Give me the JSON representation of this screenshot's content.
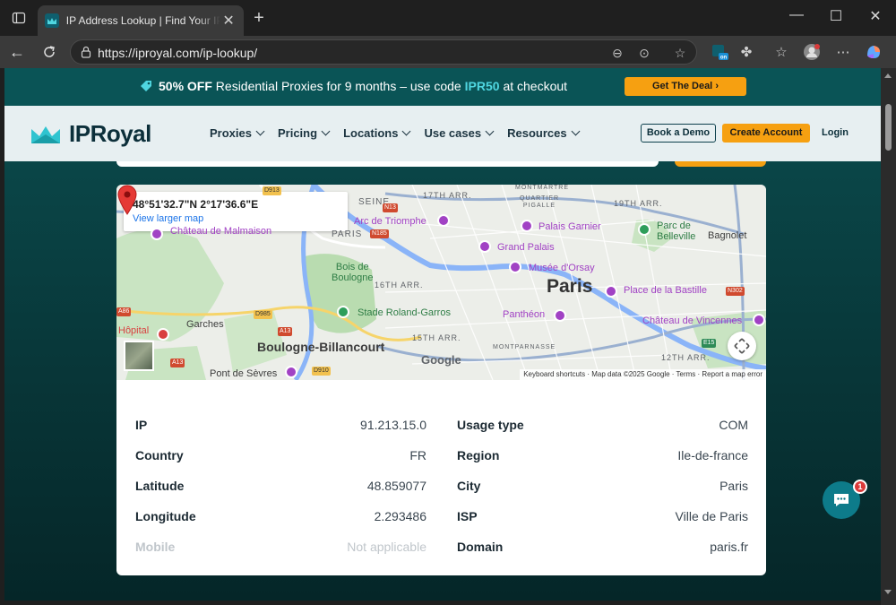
{
  "browser": {
    "tab_title": "IP Address Lookup | Find Your IP L",
    "url": "https://iproyal.com/ip-lookup/",
    "extension_badge": "on"
  },
  "promo": {
    "strong": "50% OFF",
    "text": "Residential Proxies for 9 months – use code",
    "code": "IPR50",
    "suffix": "at checkout",
    "cta": "Get The Deal"
  },
  "header": {
    "logo": "IPRoyal",
    "menu": [
      "Proxies",
      "Pricing",
      "Locations",
      "Use cases",
      "Resources"
    ],
    "book_demo": "Book a Demo",
    "create_account": "Create Account",
    "login": "Login"
  },
  "map": {
    "coordinates": "48°51'32.7\"N 2°17'36.6\"E",
    "view_larger": "View larger map",
    "labels": {
      "paris": "Paris",
      "arc": "Arc de Triomphe",
      "grand_palais": "Grand Palais",
      "palais_garnier": "Palais Garnier",
      "musee": "Musée d'Orsay",
      "bois": "Bois de\nBoulogne",
      "stade": "Stade Roland-Garros",
      "pantheon": "Panthéon",
      "bastille": "Place de la Bastille",
      "vincennes": "Château de Vincennes",
      "boulogne": "Boulogne-Billancourt",
      "garches": "Garches",
      "hopital": "Hôpital",
      "pont_sevres": "Pont de Sèvres",
      "malmaison": "Château de Malmaison",
      "belleville": "Parc de\nBelleville",
      "bagnolet": "Bagnolet",
      "montmartre": "MONTMARTRE",
      "quartier_pigalle": "QUARTIER\nPIGALLE",
      "montparnasse": "MONTPARNASSE",
      "paris_small": "PARIS",
      "seine": "SEINE",
      "arr_17": "17TH ARR.",
      "arr_19": "19TH ARR.",
      "arr_16": "16TH ARR.",
      "arr_15": "15TH ARR.",
      "arr_12": "12TH ARR."
    },
    "roads": {
      "n13": "N13",
      "n185": "N185",
      "d985": "D985",
      "a13": "A13",
      "a13b": "A13",
      "d910": "D910",
      "a86": "A86",
      "n302": "N302",
      "e15": "E15",
      "d913": "D913"
    },
    "footer": {
      "keyboard": "Keyboard shortcuts",
      "data": "Map data ©2025 Google",
      "terms": "Terms",
      "report": "Report a map error"
    },
    "google": "Google"
  },
  "info": {
    "left": [
      {
        "k": "IP",
        "v": "91.213.15.0"
      },
      {
        "k": "Country",
        "v": "FR"
      },
      {
        "k": "Latitude",
        "v": "48.859077"
      },
      {
        "k": "Longitude",
        "v": "2.293486"
      },
      {
        "k": "Mobile",
        "v": "Not applicable"
      }
    ],
    "right": [
      {
        "k": "Usage type",
        "v": "COM"
      },
      {
        "k": "Region",
        "v": "Ile-de-france"
      },
      {
        "k": "City",
        "v": "Paris"
      },
      {
        "k": "ISP",
        "v": "Ville de Paris"
      },
      {
        "k": "Domain",
        "v": "paris.fr"
      }
    ]
  },
  "chat": {
    "badge": "1"
  },
  "colors": {
    "accent": "#f6a011",
    "teal": "#0b4d4f",
    "cyan_code": "#4fd6e0"
  }
}
